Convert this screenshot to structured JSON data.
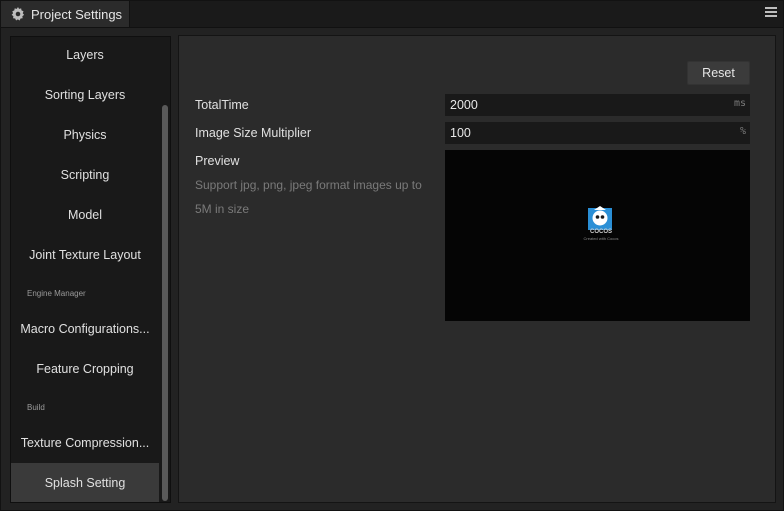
{
  "window": {
    "tab_title": "Project Settings",
    "tab_icon": "gear-icon",
    "menu_icon": "hamburger-menu-icon"
  },
  "sidebar": {
    "items": [
      {
        "label": "Layers"
      },
      {
        "label": "Sorting Layers"
      },
      {
        "label": "Physics"
      },
      {
        "label": "Scripting"
      },
      {
        "label": "Model"
      },
      {
        "label": "Joint Texture Layout"
      }
    ],
    "group_engine": "Engine Manager",
    "engine_items": [
      {
        "label": "Macro Configurations..."
      },
      {
        "label": "Feature Cropping"
      }
    ],
    "group_build": "Build",
    "build_items": [
      {
        "label": "Texture Compression..."
      },
      {
        "label": "Splash Setting",
        "active": true
      }
    ]
  },
  "splash": {
    "reset_label": "Reset",
    "total_time": {
      "label": "TotalTime",
      "value": "2000",
      "unit": "ms"
    },
    "image_size": {
      "label": "Image Size Multiplier",
      "value": "100",
      "unit": "%"
    },
    "preview": {
      "label": "Preview",
      "hint": "Support jpg, png, jpeg format images up to 5M in size",
      "logo_text": "COCOS",
      "logo_subtext": "Created with Cocos"
    }
  },
  "colors": {
    "logo_blue": "#2a8fd6",
    "active_item_bg": "#3a3a3a"
  }
}
